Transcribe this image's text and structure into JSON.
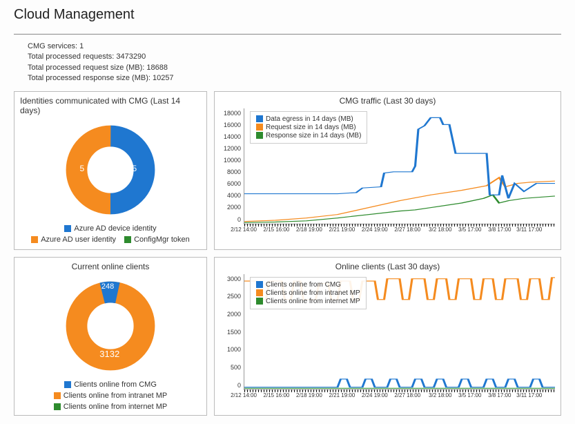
{
  "page": {
    "title": "Cloud Management"
  },
  "stats": {
    "line1": "CMG services: 1",
    "line2": "Total processed requests: 3473290",
    "line3": "Total processed request size (MB): 18688",
    "line4": "Total processed response size (MB): 10257"
  },
  "colors": {
    "blue": "#1f77d0",
    "orange": "#f58b1f",
    "green": "#2e8b2e"
  },
  "panels": {
    "identities": {
      "title": "Identities communicated with CMG (Last 14 days)",
      "legend": {
        "a": "Azure AD device identity",
        "b": "Azure AD user identity",
        "c": "ConfigMgr token"
      },
      "valueA": "5",
      "valueB": "5"
    },
    "cmgTraffic": {
      "title": "CMG traffic (Last 30 days)",
      "legend": {
        "a": "Data egress in 14 days (MB)",
        "b": "Request size in 14 days (MB)",
        "c": "Response size in 14 days (MB)"
      }
    },
    "currentOnline": {
      "title": "Current online clients",
      "legend": {
        "a": "Clients online from CMG",
        "b": "Clients online from intranet MP",
        "c": "Clients online from internet MP"
      },
      "valueA": "248",
      "valueB": "3132"
    },
    "onlineClients": {
      "title": "Online clients (Last 30 days)",
      "legend": {
        "a": "Clients online from CMG",
        "b": "Clients online from intranet MP",
        "c": "Clients online from internet MP"
      }
    }
  },
  "axes": {
    "cmgTraffic_y": [
      "18000",
      "16000",
      "14000",
      "12000",
      "10000",
      "8000",
      "6000",
      "4000",
      "2000",
      "0"
    ],
    "onlineClients_y": [
      "3000",
      "2500",
      "2000",
      "1500",
      "1000",
      "500",
      "0"
    ],
    "x_ticks": [
      "2/12 14:00",
      "2/15 16:00",
      "2/18 19:00",
      "2/21 19:00",
      "2/24 19:00",
      "2/27 18:00",
      "3/2 18:00",
      "3/5 17:00",
      "3/8 17:00",
      "3/11 17:00"
    ]
  },
  "chart_data": [
    {
      "type": "pie",
      "title": "Identities communicated with CMG (Last 14 days)",
      "series": [
        {
          "name": "Azure AD device identity",
          "value": 5,
          "color": "#1f77d0"
        },
        {
          "name": "Azure AD user identity",
          "value": 5,
          "color": "#f58b1f"
        },
        {
          "name": "ConfigMgr token",
          "value": 0,
          "color": "#2e8b2e"
        }
      ]
    },
    {
      "type": "line",
      "title": "CMG traffic (Last 30 days)",
      "xlabel": "",
      "ylabel": "",
      "ylim": [
        0,
        18000
      ],
      "x": [
        "2/12 14:00",
        "2/15 16:00",
        "2/18 19:00",
        "2/21 19:00",
        "2/24 19:00",
        "2/27 18:00",
        "3/2 18:00",
        "3/5 17:00",
        "3/8 17:00",
        "3/11 17:00"
      ],
      "series": [
        {
          "name": "Data egress in 14 days (MB)",
          "color": "#1f77d0",
          "values": [
            4600,
            4600,
            4600,
            4700,
            5600,
            8000,
            16500,
            11000,
            4500,
            6300
          ]
        },
        {
          "name": "Request size in 14 days (MB)",
          "color": "#f58b1f",
          "values": [
            300,
            500,
            900,
            1500,
            2600,
            3600,
            4500,
            5300,
            6100,
            6600
          ]
        },
        {
          "name": "Response size in 14 days (MB)",
          "color": "#2e8b2e",
          "values": [
            100,
            200,
            400,
            800,
            1400,
            2000,
            2600,
            3200,
            3900,
            4300
          ]
        }
      ]
    },
    {
      "type": "pie",
      "title": "Current online clients",
      "series": [
        {
          "name": "Clients online from CMG",
          "value": 248,
          "color": "#1f77d0"
        },
        {
          "name": "Clients online from intranet MP",
          "value": 3132,
          "color": "#f58b1f"
        },
        {
          "name": "Clients online from internet MP",
          "value": 0,
          "color": "#2e8b2e"
        }
      ]
    },
    {
      "type": "line",
      "title": "Online clients (Last 30 days)",
      "xlabel": "",
      "ylabel": "",
      "ylim": [
        0,
        3200
      ],
      "x": [
        "2/12 14:00",
        "2/15 16:00",
        "2/18 19:00",
        "2/21 19:00",
        "2/24 19:00",
        "2/27 18:00",
        "3/2 18:00",
        "3/5 17:00",
        "3/8 17:00",
        "3/11 17:00"
      ],
      "series": [
        {
          "name": "Clients online from CMG",
          "color": "#1f77d0",
          "values": [
            20,
            20,
            20,
            20,
            20,
            20,
            20,
            20,
            20,
            20
          ],
          "peaks": 250
        },
        {
          "name": "Clients online from intranet MP",
          "color": "#f58b1f",
          "values": [
            3050,
            3050,
            2550,
            2550,
            3050,
            3050,
            3050,
            3050,
            3050,
            3050
          ],
          "dips": 2550
        },
        {
          "name": "Clients online from internet MP",
          "color": "#2e8b2e",
          "values": [
            5,
            5,
            5,
            5,
            5,
            5,
            5,
            5,
            5,
            5
          ]
        }
      ]
    }
  ]
}
